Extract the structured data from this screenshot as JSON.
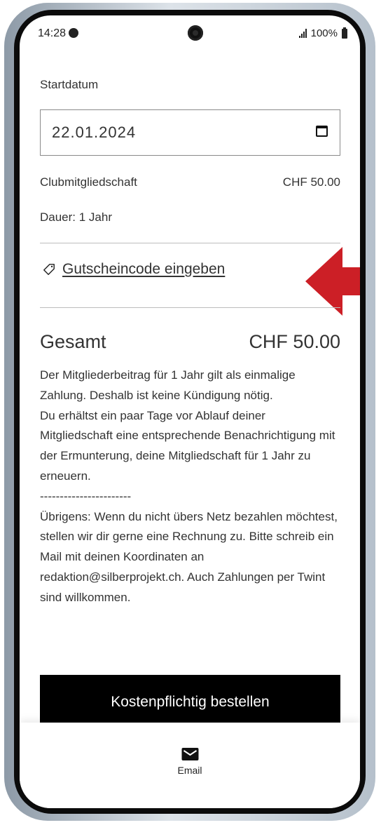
{
  "status": {
    "time": "14:28",
    "battery": "100%"
  },
  "form": {
    "start_label": "Startdatum",
    "date_value": "22.01.2024",
    "membership_name": "Clubmitgliedschaft",
    "membership_price": "CHF 50.00",
    "duration": "Dauer: 1 Jahr",
    "coupon_link": "Gutscheincode eingeben",
    "total_label": "Gesamt",
    "total_price": "CHF 50.00",
    "description": [
      "Der Mitgliederbeitrag für 1 Jahr gilt als einmalige Zahlung. Deshalb ist keine Kündigung nötig.",
      "Du erhältst ein paar Tage vor Ablauf deiner Mitgliedschaft eine entsprechende Benachrichtigung mit der Ermunterung, deine Mitgliedschaft für 1 Jahr zu erneuern.",
      "-----------------------",
      "Übrigens: Wenn du nicht übers Netz bezahlen möchtest, stellen wir dir gerne eine Rechnung zu. Bitte schreib ein Mail mit deinen Koordinaten an redaktion@silberprojekt.ch. Auch Zahlungen per Twint sind willkommen."
    ],
    "order_button": "Kostenpflichtig bestellen"
  },
  "bottom": {
    "email_label": "Email"
  },
  "colors": {
    "button_bg": "#000000",
    "annotation_arrow": "#cc1f26"
  },
  "icons": [
    "status-dot-icon",
    "camera-icon",
    "signal-icon",
    "battery-icon",
    "calendar-icon",
    "tag-icon",
    "red-arrow-icon",
    "mail-icon"
  ]
}
